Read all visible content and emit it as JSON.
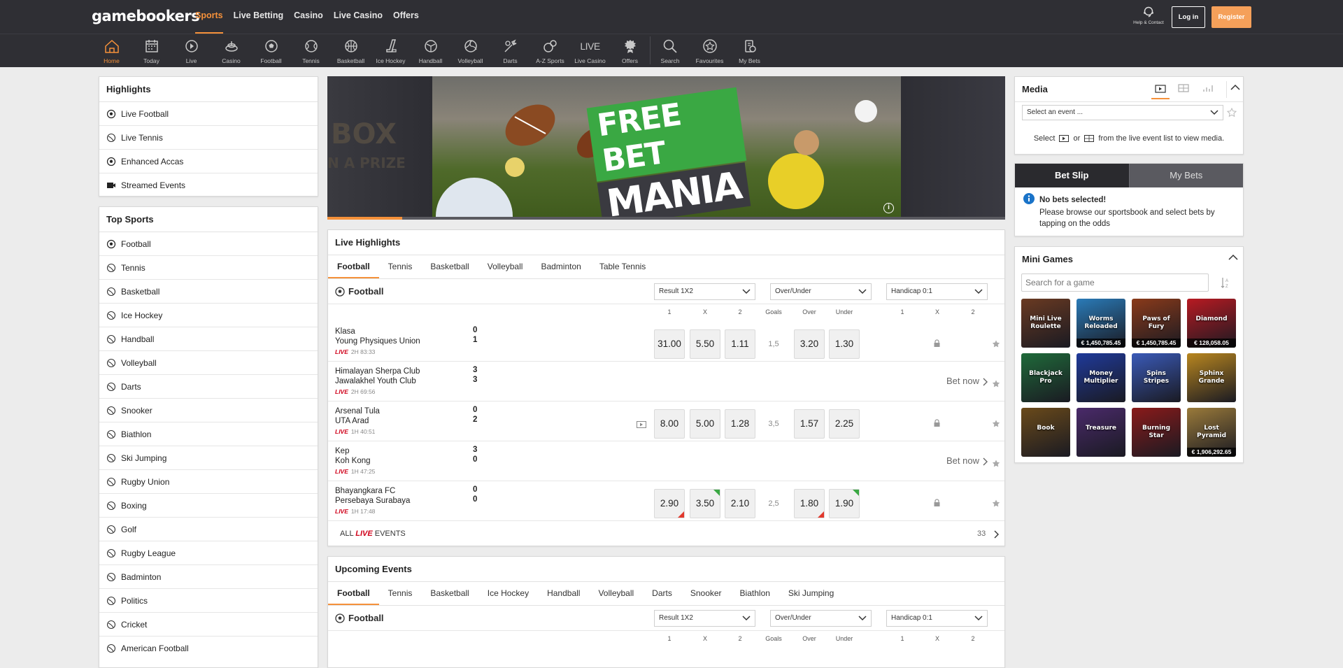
{
  "header": {
    "logo": "gamebookers",
    "nav": [
      "Sports",
      "Live Betting",
      "Casino",
      "Live Casino",
      "Offers"
    ],
    "help_label": "Help & Contact",
    "login_label": "Log in",
    "register_label": "Register"
  },
  "icon_nav": [
    {
      "label": "Home",
      "icon": "home-icon"
    },
    {
      "label": "Today",
      "icon": "calendar-icon"
    },
    {
      "label": "Live",
      "icon": "live-icon"
    },
    {
      "label": "Casino",
      "icon": "casino-icon"
    },
    {
      "label": "Football",
      "icon": "football-icon"
    },
    {
      "label": "Tennis",
      "icon": "tennis-icon"
    },
    {
      "label": "Basketball",
      "icon": "basketball-icon"
    },
    {
      "label": "Ice Hockey",
      "icon": "ice-hockey-icon"
    },
    {
      "label": "Handball",
      "icon": "handball-icon"
    },
    {
      "label": "Volleyball",
      "icon": "volleyball-icon"
    },
    {
      "label": "Darts",
      "icon": "darts-icon"
    },
    {
      "label": "A-Z Sports",
      "icon": "az-sports-icon"
    },
    {
      "label": "Live Casino",
      "icon": "live-casino-icon",
      "text": "LIVE"
    },
    {
      "label": "Offers",
      "icon": "offers-icon"
    },
    {
      "label": "Search",
      "icon": "search-icon"
    },
    {
      "label": "Favourites",
      "icon": "star-icon"
    },
    {
      "label": "My Bets",
      "icon": "my-bets-icon"
    }
  ],
  "highlights": {
    "title": "Highlights",
    "items": [
      "Live Football",
      "Live Tennis",
      "Enhanced Accas",
      "Streamed Events"
    ]
  },
  "top_sports": {
    "title": "Top Sports",
    "items": [
      "Football",
      "Tennis",
      "Basketball",
      "Ice Hockey",
      "Handball",
      "Volleyball",
      "Darts",
      "Snooker",
      "Biathlon",
      "Ski Jumping",
      "Rugby Union",
      "Boxing",
      "Golf",
      "Rugby League",
      "Badminton",
      "Politics",
      "Cricket",
      "American Football"
    ]
  },
  "banner": {
    "line1": "FREE BET",
    "line2": "MANIA",
    "side_text1": "BOX",
    "side_text2": "N A PRIZE",
    "progress": 0.11
  },
  "live_highlights": {
    "title": "Live Highlights",
    "tabs": [
      "Football",
      "Tennis",
      "Basketball",
      "Volleyball",
      "Badminton",
      "Table Tennis"
    ],
    "sport": "Football",
    "selects": [
      "Result 1X2",
      "Over/Under",
      "Handicap 0:1"
    ],
    "col_heads": {
      "r1": "1",
      "rx": "X",
      "r2": "2",
      "goals": "Goals",
      "over": "Over",
      "under": "Under",
      "h1": "1",
      "hx": "X",
      "h2": "2"
    },
    "matches": [
      {
        "home": "Klasa",
        "away": "Young Physiques Union",
        "sh": "0",
        "sa": "1",
        "live": "LIVE",
        "time": "2H 83:33",
        "o1": "31.00",
        "ox": "5.50",
        "o2": "1.11",
        "goals": "1,5",
        "over": "3.20",
        "under": "1.30"
      },
      {
        "home": "Himalayan Sherpa Club",
        "away": "Jawalakhel Youth Club",
        "sh": "3",
        "sa": "3",
        "live": "LIVE",
        "time": "2H 69:56",
        "betnow": "Bet now"
      },
      {
        "home": "Arsenal Tula",
        "away": "UTA Arad",
        "sh": "0",
        "sa": "2",
        "live": "LIVE",
        "time": "1H 40:51",
        "o1": "8.00",
        "ox": "5.00",
        "o2": "1.28",
        "goals": "3,5",
        "over": "1.57",
        "under": "2.25"
      },
      {
        "home": "Kep",
        "away": "Koh Kong",
        "sh": "3",
        "sa": "0",
        "live": "LIVE",
        "time": "1H 47:25",
        "betnow": "Bet now"
      },
      {
        "home": "Bhayangkara FC",
        "away": "Persebaya Surabaya",
        "sh": "0",
        "sa": "0",
        "live": "LIVE",
        "time": "1H 17:48",
        "o1": "2.90",
        "ox": "3.50",
        "o2": "2.10",
        "goals": "2,5",
        "over": "1.80",
        "under": "1.90"
      }
    ],
    "all_pre": "ALL",
    "all_live": "LIVE",
    "all_post": "EVENTS",
    "all_count": "33"
  },
  "upcoming": {
    "title": "Upcoming Events",
    "tabs": [
      "Football",
      "Tennis",
      "Basketball",
      "Ice Hockey",
      "Handball",
      "Volleyball",
      "Darts",
      "Snooker",
      "Biathlon",
      "Ski Jumping"
    ],
    "sport": "Football",
    "selects": [
      "Result 1X2",
      "Over/Under",
      "Handicap 0:1"
    ],
    "col_heads": {
      "r1": "1",
      "rx": "X",
      "r2": "2",
      "goals": "Goals",
      "over": "Over",
      "under": "Under",
      "h1": "1",
      "hx": "X",
      "h2": "2"
    }
  },
  "media": {
    "title": "Media",
    "select_placeholder": "Select an event ...",
    "hint_pre": "Select",
    "hint_or": "or",
    "hint_post": "from the live event list to view media."
  },
  "betslip": {
    "tab_active": "Bet Slip",
    "tab_other": "My Bets",
    "title": "No bets selected!",
    "message": "Please browse our sportsbook and select bets by tapping on the odds"
  },
  "mini_games": {
    "title": "Mini Games",
    "search_placeholder": "Search for a game",
    "games": [
      {
        "name": "Mini Live Roulette",
        "jackpot": "",
        "color": "#6a3a22"
      },
      {
        "name": "Worms Reloaded",
        "jackpot": "€ 1,450,785.45",
        "color": "#2a7bb8"
      },
      {
        "name": "Paws of Fury",
        "jackpot": "€ 1,450,785.45",
        "color": "#8a3a1a"
      },
      {
        "name": "Diamond",
        "jackpot": "€ 128,058.05",
        "color": "#b81a22"
      },
      {
        "name": "Blackjack Pro",
        "jackpot": "",
        "color": "#1f6a3a"
      },
      {
        "name": "Money Multiplier",
        "jackpot": "",
        "color": "#1f3a9a"
      },
      {
        "name": "Spins Stripes",
        "jackpot": "",
        "color": "#3a5ab8"
      },
      {
        "name": "Sphinx Grande",
        "jackpot": "",
        "color": "#b8861f"
      },
      {
        "name": "Book",
        "jackpot": "",
        "color": "#6a4a1a"
      },
      {
        "name": "Treasure",
        "jackpot": "",
        "color": "#4a2a6a"
      },
      {
        "name": "Burning Star",
        "jackpot": "",
        "color": "#8a1a1a"
      },
      {
        "name": "Lost Pyramid",
        "jackpot": "€ 1,906,292.65",
        "color": "#9a7a3a"
      }
    ]
  }
}
